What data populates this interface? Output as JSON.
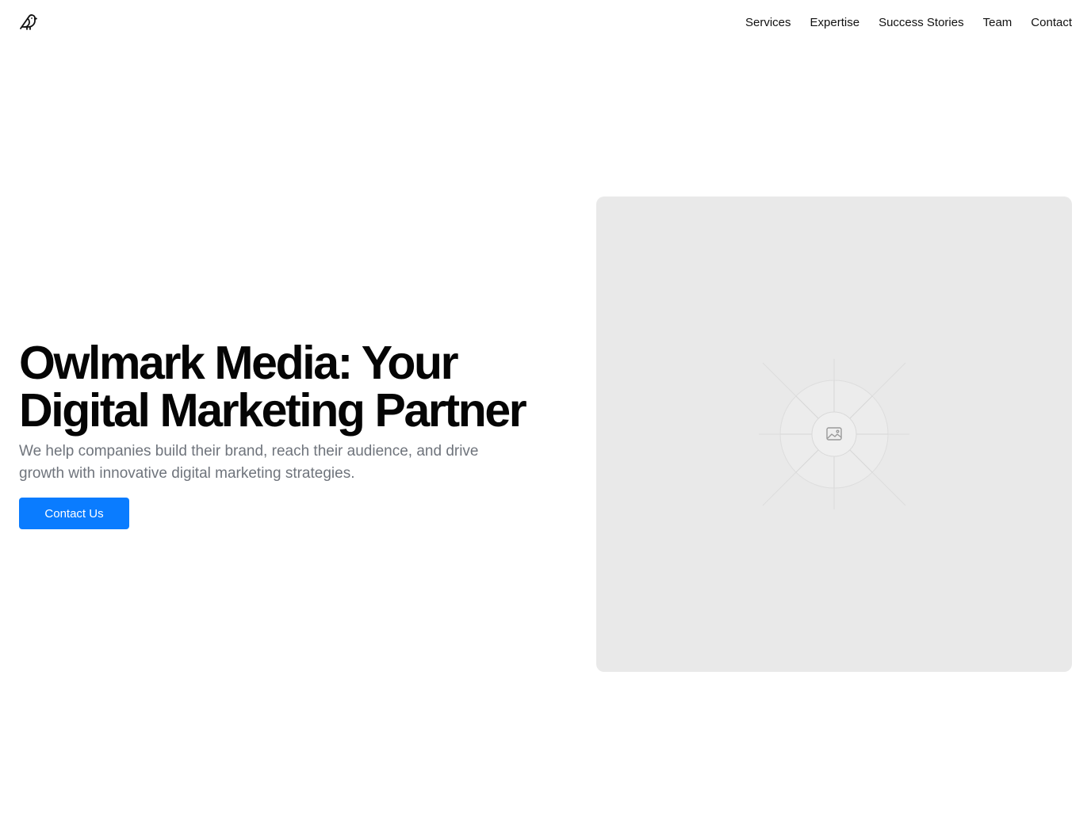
{
  "header": {
    "logo_icon": "bird-icon",
    "nav": [
      {
        "label": "Services"
      },
      {
        "label": "Expertise"
      },
      {
        "label": "Success Stories"
      },
      {
        "label": "Team"
      },
      {
        "label": "Contact"
      }
    ]
  },
  "hero": {
    "title": "Owlmark Media: Your Digital Marketing Partner",
    "subtitle": "We help companies build their brand, reach their audience, and drive growth with innovative digital marketing strategies.",
    "cta_label": "Contact Us",
    "image_icon": "image-placeholder-icon"
  },
  "colors": {
    "accent": "#0a7cff",
    "placeholder_bg": "#e9e9e9",
    "subtitle_text": "#6f747c"
  }
}
